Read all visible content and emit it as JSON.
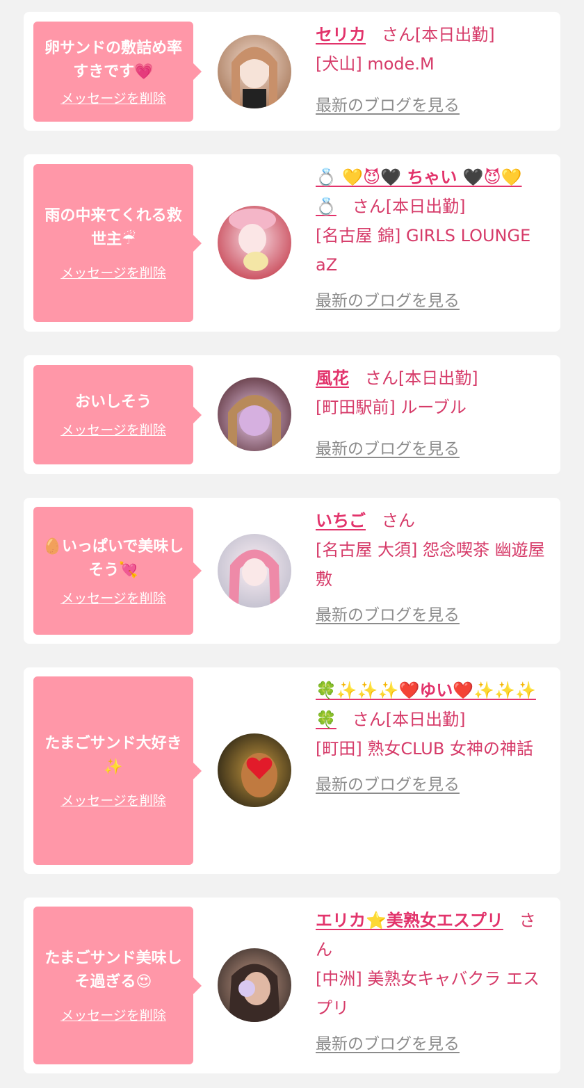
{
  "common": {
    "delete_label": "メッセージを削除",
    "blog_label": "最新のブログを見る"
  },
  "colors": {
    "bubble": "#ff97a8",
    "name": "#e2336b",
    "text": "#d63b69",
    "link_gray": "#8c8c8c",
    "background": "#f2f2f2"
  },
  "cards": [
    {
      "message": "卵サンドの敷詰め率すきです💗",
      "name": "セリカ",
      "status": "さん[本日出勤]",
      "shop": "[犬山] mode.M",
      "avatar_colors": [
        "#c89a7e",
        "#f0d6c8"
      ]
    },
    {
      "message": "雨の中来てくれる救世主☔",
      "name": "💍 💛😈🖤 ちゃい 🖤😈💛 💍",
      "status": "さん[本日出勤]",
      "shop": "[名古屋 錦] GIRLS LOUNGE aZ",
      "avatar_colors": [
        "#c83a4a",
        "#f5c6d0"
      ]
    },
    {
      "message": "おいしそう",
      "name": "風花",
      "status": "さん[本日出勤]",
      "shop": "[町田駅前] ルーブル",
      "avatar_colors": [
        "#8a5a6a",
        "#e6a6c0"
      ]
    },
    {
      "message": "🥚いっぱいで美味しそう💘",
      "name": "いちご",
      "status": "さん",
      "shop": "[名古屋 大須] 怨念喫茶 幽遊屋敷",
      "avatar_colors": [
        "#c8c8d8",
        "#f0b4cc"
      ]
    },
    {
      "message": "たまごサンド大好き✨",
      "name": "🍀✨✨✨❤️ゆい❤️✨✨✨🍀",
      "status": "さん[本日出勤]",
      "shop": "[町田] 熟女CLUB 女神の神話",
      "avatar_colors": [
        "#3a3020",
        "#a08040"
      ]
    },
    {
      "message": "たまごサンド美味しそ過ぎる😍",
      "name": "エリカ⭐美熟女エスプリ",
      "status": "さん",
      "shop": "[中洲] 美熟女キャバクラ エスプリ",
      "avatar_colors": [
        "#4a3a36",
        "#c49a86"
      ]
    }
  ]
}
